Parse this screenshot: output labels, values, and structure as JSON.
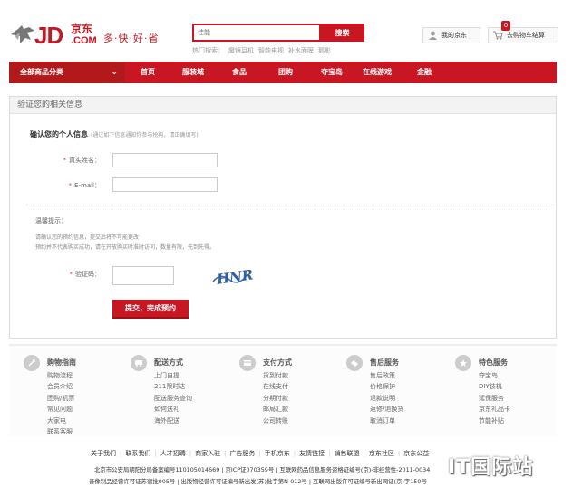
{
  "header": {
    "logo_jd": "JD",
    "logo_cn": "京东",
    "logo_com": ".COM",
    "slogan": "多·快·好·省",
    "search_placeholder": "佳能",
    "search_button": "搜索",
    "hot_search_label": "热门搜索：",
    "hot_search_items": [
      "魔镜耳机",
      "智能电视",
      "补水面膜",
      "鹅影"
    ],
    "my_jd": "我的京东",
    "cart_label": "去购物车结算",
    "cart_count": "0"
  },
  "nav": {
    "all_categories": "全部商品分类",
    "links": [
      "首页",
      "服装城",
      "食品",
      "团购",
      "夺宝岛",
      "在线游戏",
      "金融"
    ]
  },
  "form": {
    "panel_title": "验证您的相关信息",
    "section_title": "确认您的个人信息",
    "section_note": "(通过如下信息通知你参与抢购，请正确填写)",
    "name_label": "真实姓名：",
    "email_label": "E-mail：",
    "tip_title": "温馨提示：",
    "tip_line1": "请确认您的预约信息，提交后将不可能更改",
    "tip_line2": "预约并不代表购买成功，请在开放购买时准时访问，数量有限，先到先得。",
    "captcha_label": "验证码：",
    "captcha_text": "HNR",
    "submit_label": "提交，完成预约"
  },
  "footer": {
    "columns": [
      {
        "title": "购物指南",
        "icon": "guide-icon",
        "items": [
          "购物流程",
          "会员介绍",
          "团购/机票",
          "常见问题",
          "大家电",
          "联系客服"
        ]
      },
      {
        "title": "配送方式",
        "icon": "truck-icon",
        "items": [
          "上门自提",
          "211限时达",
          "配送服务查询",
          "如何送礼",
          "海外配送"
        ]
      },
      {
        "title": "支付方式",
        "icon": "payment-icon",
        "items": [
          "货到付款",
          "在线支付",
          "分期付款",
          "邮局汇款",
          "公司转账"
        ]
      },
      {
        "title": "售后服务",
        "icon": "aftersale-icon",
        "items": [
          "售后政策",
          "价格保护",
          "退款说明",
          "返修/退换货",
          "取消订单"
        ]
      },
      {
        "title": "特色服务",
        "icon": "feature-icon",
        "items": [
          "夺宝岛",
          "DIY装机",
          "延保服务",
          "京东礼品卡",
          "节能补贴"
        ]
      }
    ],
    "bottom_links": [
      "关于我们",
      "联系我们",
      "人才招聘",
      "商家入驻",
      "广告服务",
      "手机京东",
      "友情链接",
      "销售联盟",
      "京东社区",
      "京东公益"
    ],
    "copyright1": "北京市公安局朝阳分局备案编号110105014669 | 京ICP证070359号 | 互联网药品信息服务资格证编号(京)-非经营性-2011-0034",
    "copyright2": "音像制品经营许可证苏宿批005号 | 出版物经营许可证编号新出发(苏)批字第N-012号 | 互联网出版许可证编号新出网证(京)字150号",
    "watermark": "IT国际站"
  },
  "colors": {
    "brand_red": "#c81623",
    "nav_dark_red": "#b1191a"
  }
}
